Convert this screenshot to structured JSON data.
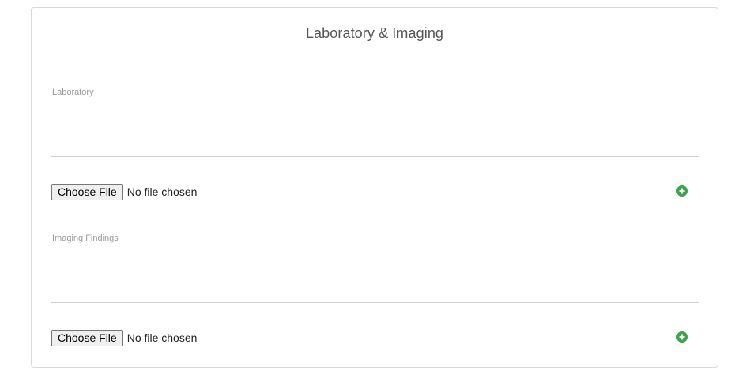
{
  "section": {
    "title": "Laboratory & Imaging"
  },
  "laboratory": {
    "label": "Laboratory",
    "value": "",
    "file_button_label": "Choose File",
    "file_status": "No file chosen"
  },
  "imaging": {
    "label": "Imaging Findings",
    "value": "",
    "file_button_label": "Choose File",
    "file_status": "No file chosen"
  },
  "icons": {
    "add": "plus-circle-icon"
  },
  "colors": {
    "accent_green": "#3fa34d",
    "border": "#d9d9d9",
    "label": "#9a9a9a",
    "title": "#555555"
  }
}
